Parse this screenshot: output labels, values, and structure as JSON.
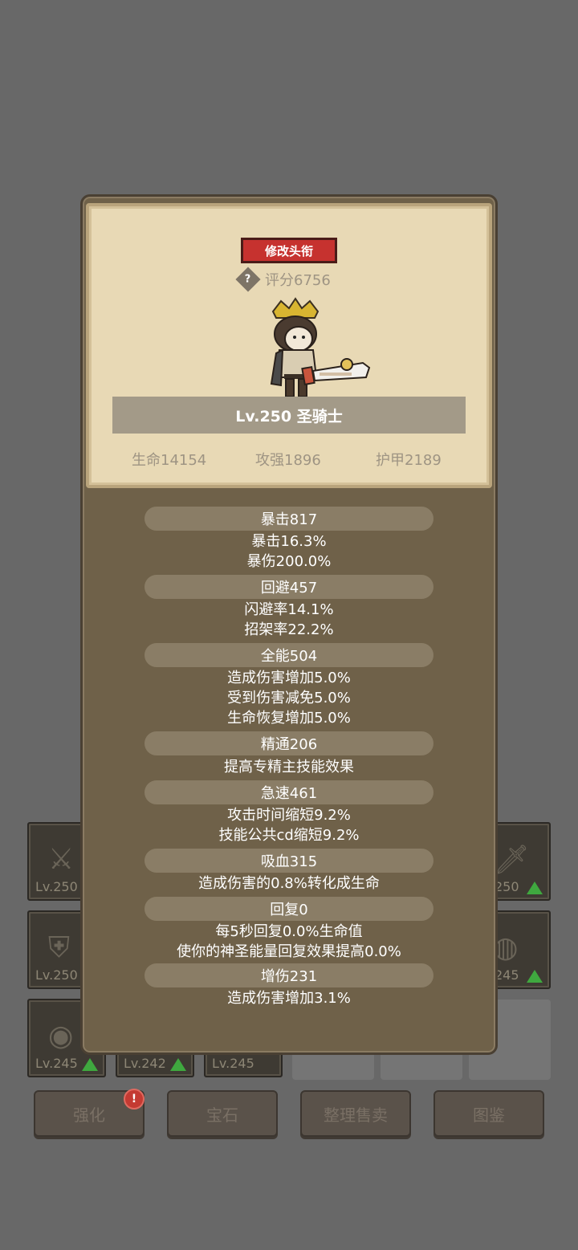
{
  "background_slots": [
    {
      "lv": "Lv.250",
      "up": false,
      "icon": "sword-icon"
    },
    {
      "lv": "250",
      "up": true,
      "icon": "blade-icon"
    },
    {
      "lv": "Lv.250",
      "up": false,
      "icon": "armor-icon"
    },
    {
      "lv": "245",
      "up": true,
      "icon": "ring-icon"
    },
    {
      "lv": "Lv.245",
      "up": true,
      "icon": "shield-icon"
    },
    {
      "lv": "Lv.242",
      "up": true,
      "icon": "gear-icon"
    },
    {
      "lv": "Lv.245",
      "up": false,
      "icon": "gear-icon"
    }
  ],
  "bottom_buttons": {
    "enhance": "强化",
    "gem": "宝石",
    "sort_sell": "整理售卖",
    "codex": "图鉴",
    "enhance_badge": "!"
  },
  "card": {
    "rename_button": "修改头衔",
    "help_icon": "?",
    "score": "评分6756",
    "title": "Lv.250 圣骑士",
    "hp": "生命14154",
    "attack": "攻强1896",
    "armor": "护甲2189"
  },
  "stats": [
    {
      "header": "暴击817",
      "lines": [
        "暴击16.3%",
        "暴伤200.0%"
      ]
    },
    {
      "header": "回避457",
      "lines": [
        "闪避率14.1%",
        "招架率22.2%"
      ]
    },
    {
      "header": "全能504",
      "lines": [
        "造成伤害增加5.0%",
        "受到伤害减免5.0%",
        "生命恢复增加5.0%"
      ]
    },
    {
      "header": "精通206",
      "lines": [
        "提高专精主技能效果"
      ]
    },
    {
      "header": "急速461",
      "lines": [
        "攻击时间缩短9.2%",
        "技能公共cd缩短9.2%"
      ]
    },
    {
      "header": "吸血315",
      "lines": [
        "造成伤害的0.8%转化成生命"
      ]
    },
    {
      "header": "回复0",
      "lines": [
        "每5秒回复0.0%生命值",
        "使你的神圣能量回复效果提高0.0%"
      ]
    },
    {
      "header": "增伤231",
      "lines": [
        "造成伤害增加3.1%"
      ]
    }
  ],
  "colors": {
    "panel": "#6f6149",
    "card": "#e8d9b5",
    "rename": "#c6322f",
    "up_arrow": "#3fa83f"
  }
}
